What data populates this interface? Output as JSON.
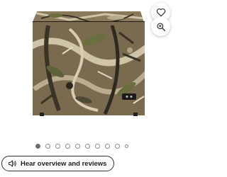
{
  "product": {
    "image_alt": "Camouflage chest freezer",
    "pattern_colors": {
      "base": "#7a6a50",
      "light": "#cfc3a8",
      "dark": "#3a3326",
      "green": "#6b6e3f"
    }
  },
  "actions": {
    "favorite_icon": "heart-icon",
    "zoom_icon": "zoom-in-icon"
  },
  "carousel": {
    "total": 10,
    "active_index": 0
  },
  "audio_button": {
    "icon": "speaker-icon",
    "label": "Hear overview and reviews"
  }
}
